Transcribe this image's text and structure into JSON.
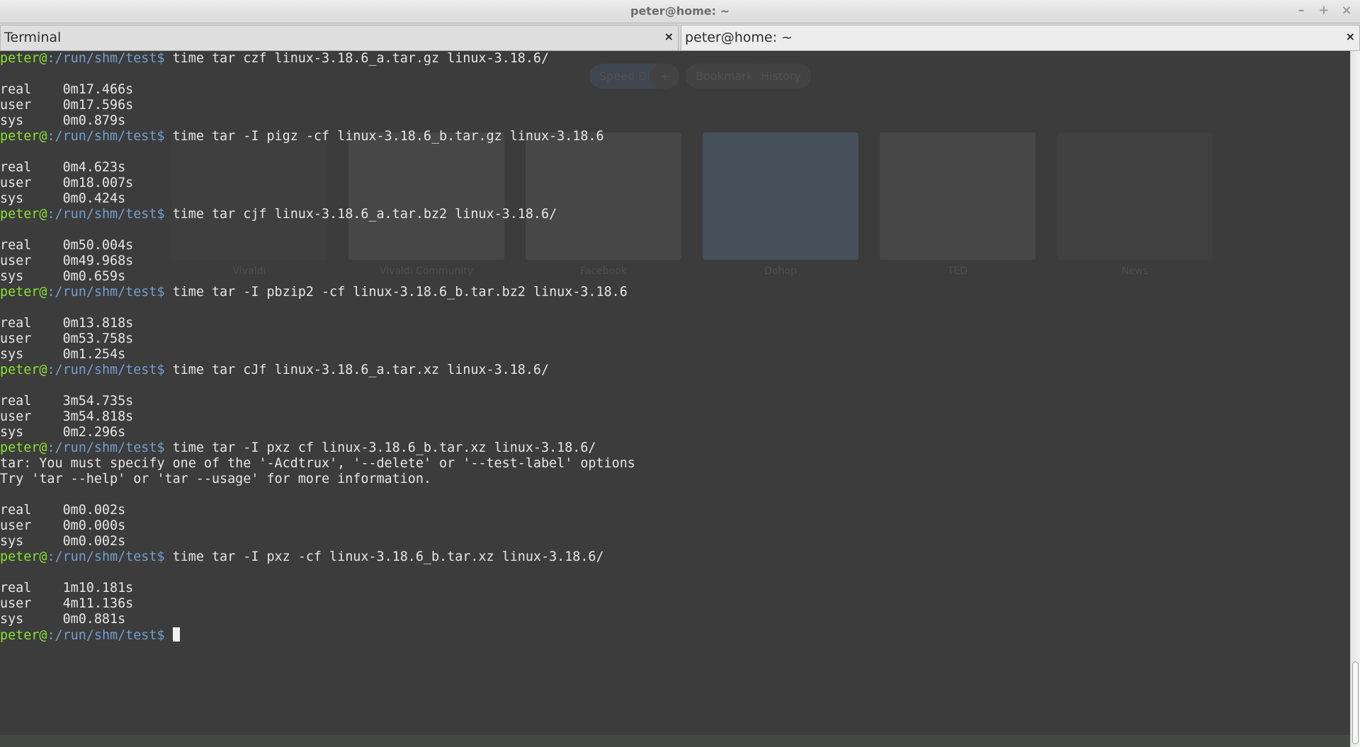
{
  "window": {
    "title": "peter@home: ~",
    "controls": {
      "minimize": "–",
      "maximize": "+",
      "close": "×"
    }
  },
  "tabs": [
    {
      "label": "Terminal",
      "close": "×",
      "active": false
    },
    {
      "label": "peter@home: ~",
      "close": "×",
      "active": true
    }
  ],
  "prompt": {
    "user": "peter@",
    "separator": ":",
    "path": "/run/shm/test",
    "symbol": "$ ",
    "colors": {
      "user": "#8ae234",
      "path": "#729fcf",
      "text": "#e6e6e6",
      "background": "#3c3c3c"
    }
  },
  "terminal": {
    "lines": [
      {
        "type": "prompt",
        "command": "time tar czf linux-3.18.6_a.tar.gz linux-3.18.6/"
      },
      {
        "type": "output",
        "text": ""
      },
      {
        "type": "output",
        "text": "real\t0m17.466s"
      },
      {
        "type": "output",
        "text": "user\t0m17.596s"
      },
      {
        "type": "output",
        "text": "sys\t0m0.879s"
      },
      {
        "type": "prompt",
        "command": "time tar -I pigz -cf linux-3.18.6_b.tar.gz linux-3.18.6"
      },
      {
        "type": "output",
        "text": ""
      },
      {
        "type": "output",
        "text": "real\t0m4.623s"
      },
      {
        "type": "output",
        "text": "user\t0m18.007s"
      },
      {
        "type": "output",
        "text": "sys\t0m0.424s"
      },
      {
        "type": "prompt",
        "command": "time tar cjf linux-3.18.6_a.tar.bz2 linux-3.18.6/"
      },
      {
        "type": "output",
        "text": ""
      },
      {
        "type": "output",
        "text": "real\t0m50.004s"
      },
      {
        "type": "output",
        "text": "user\t0m49.968s"
      },
      {
        "type": "output",
        "text": "sys\t0m0.659s"
      },
      {
        "type": "prompt",
        "command": "time tar -I pbzip2 -cf linux-3.18.6_b.tar.bz2 linux-3.18.6"
      },
      {
        "type": "output",
        "text": ""
      },
      {
        "type": "output",
        "text": "real\t0m13.818s"
      },
      {
        "type": "output",
        "text": "user\t0m53.758s"
      },
      {
        "type": "output",
        "text": "sys\t0m1.254s"
      },
      {
        "type": "prompt",
        "command": "time tar cJf linux-3.18.6_a.tar.xz linux-3.18.6/"
      },
      {
        "type": "output",
        "text": ""
      },
      {
        "type": "output",
        "text": "real\t3m54.735s"
      },
      {
        "type": "output",
        "text": "user\t3m54.818s"
      },
      {
        "type": "output",
        "text": "sys\t0m2.296s"
      },
      {
        "type": "prompt",
        "command": "time tar -I pxz cf linux-3.18.6_b.tar.xz linux-3.18.6/"
      },
      {
        "type": "output",
        "text": "tar: You must specify one of the '-Acdtrux', '--delete' or '--test-label' options"
      },
      {
        "type": "output",
        "text": "Try 'tar --help' or 'tar --usage' for more information."
      },
      {
        "type": "output",
        "text": ""
      },
      {
        "type": "output",
        "text": "real\t0m0.002s"
      },
      {
        "type": "output",
        "text": "user\t0m0.000s"
      },
      {
        "type": "output",
        "text": "sys\t0m0.002s"
      },
      {
        "type": "prompt",
        "command": "time tar -I pxz -cf linux-3.18.6_b.tar.xz linux-3.18.6/"
      },
      {
        "type": "output",
        "text": ""
      },
      {
        "type": "output",
        "text": "real\t1m10.181s"
      },
      {
        "type": "output",
        "text": "user\t4m11.136s"
      },
      {
        "type": "output",
        "text": "sys\t0m0.881s"
      },
      {
        "type": "prompt",
        "command": "",
        "cursor": true
      }
    ]
  },
  "scrollbar": {
    "position_fraction": 0.88,
    "visible_fraction": 0.12
  },
  "background_ghost": {
    "browser_tabs": [
      "Speed Dial",
      "+",
      "Bookmarks",
      "History"
    ],
    "speed_dial": [
      "Vivaldi",
      "Vivaldi Community",
      "Facebook",
      "Dohop",
      "TED",
      "News"
    ]
  }
}
